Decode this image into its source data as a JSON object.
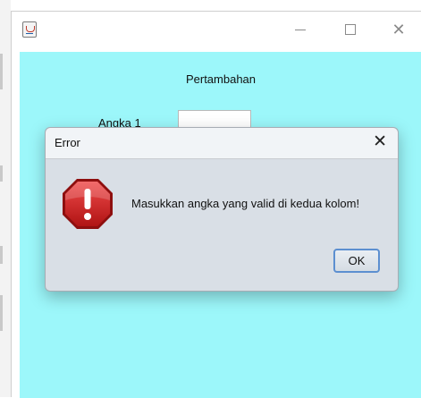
{
  "window": {
    "title": "",
    "icon": "java-app-icon"
  },
  "form": {
    "heading": "Pertambahan",
    "angka1_label": "Angka 1",
    "angka1_value": ""
  },
  "dialog": {
    "title": "Error",
    "message": "Masukkan angka yang valid di kedua kolom!",
    "ok_label": "OK",
    "icon": "error-octagon-icon"
  },
  "colors": {
    "content_bg": "#9cf7fa",
    "dialog_bg": "#d9dfe6",
    "error_red": "#cc1f1f"
  }
}
